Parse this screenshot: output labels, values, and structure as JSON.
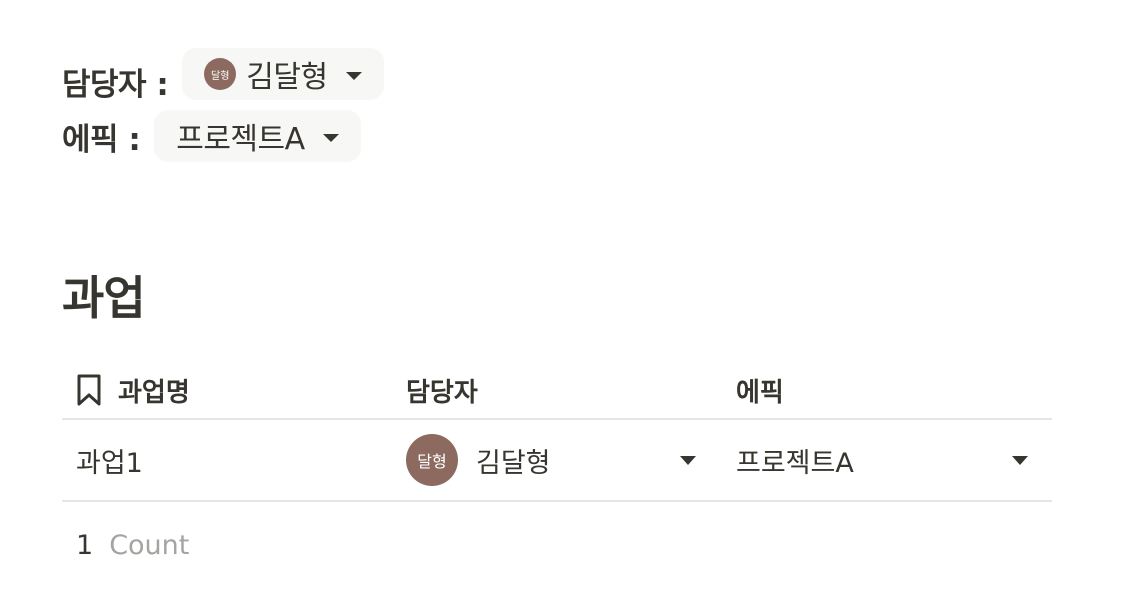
{
  "properties": {
    "assignee": {
      "label": "담당자 :",
      "avatar_text": "달형",
      "value": "김달형"
    },
    "epic": {
      "label": "에픽 :",
      "value": "프로젝트A"
    }
  },
  "section": {
    "title": "과업"
  },
  "table": {
    "headers": {
      "name": "과업명",
      "assignee": "담당자",
      "epic": "에픽"
    },
    "rows": [
      {
        "name": "과업1",
        "assignee_avatar": "달형",
        "assignee": "김달형",
        "epic": "프로젝트A"
      }
    ],
    "footer": {
      "count": "1",
      "count_label": "Count"
    }
  },
  "colors": {
    "avatar": "#8c6a60",
    "text": "#37352f",
    "muted": "#a4a4a1",
    "pill_bg": "#f7f7f5",
    "divider": "#e6e6e4"
  },
  "icons": {
    "header_name": "bookmark-icon",
    "dropdown": "caret-down-icon"
  }
}
